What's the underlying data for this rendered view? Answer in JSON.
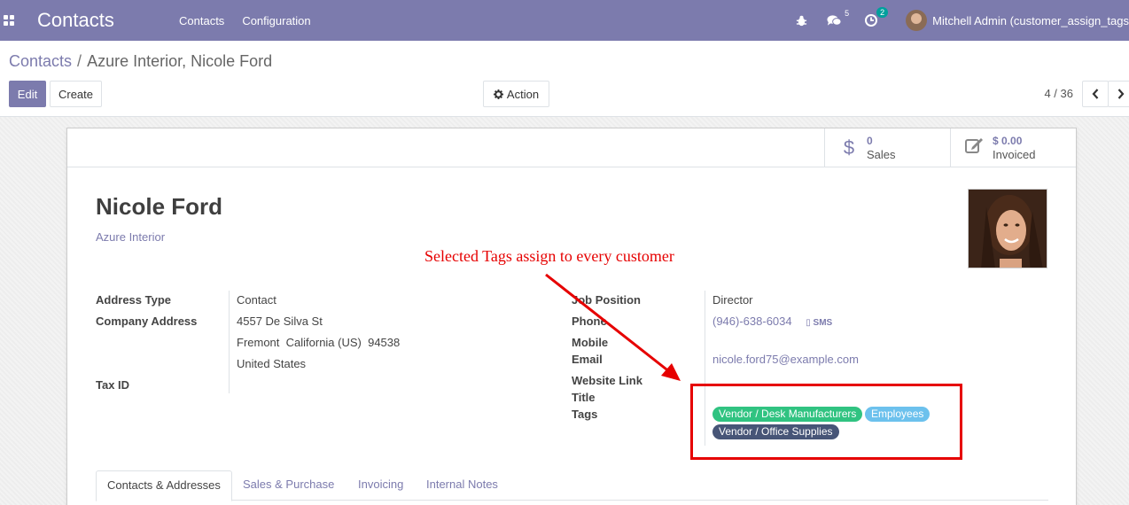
{
  "navbar": {
    "app_title": "Contacts",
    "menu": [
      "Contacts",
      "Configuration"
    ],
    "messages_count": "5",
    "activities_count": "2",
    "user_name": "Mitchell Admin (customer_assign_tags"
  },
  "breadcrumb": {
    "parent": "Contacts",
    "separator": "/",
    "current": "Azure Interior, Nicole Ford"
  },
  "toolbar": {
    "edit_label": "Edit",
    "create_label": "Create",
    "action_label": "Action",
    "pager": "4 / 36"
  },
  "stats": {
    "sales_value": "0",
    "sales_label": "Sales",
    "invoiced_value": "$ 0.00",
    "invoiced_label": "Invoiced"
  },
  "partner": {
    "name": "Nicole Ford",
    "company": "Azure Interior"
  },
  "left_fields": {
    "address_type_label": "Address Type",
    "address_type_value": "Contact",
    "company_address_label": "Company Address",
    "street": "4557 De Silva St",
    "city_line": "Fremont  California (US)  94538",
    "country": "United States",
    "tax_id_label": "Tax ID"
  },
  "right_fields": {
    "job_position_label": "Job Position",
    "job_position_value": "Director",
    "phone_label": "Phone",
    "phone_value": "(946)-638-6034",
    "sms_label": "SMS",
    "mobile_label": "Mobile",
    "email_label": "Email",
    "email_value": "nicole.ford75@example.com",
    "website_label": "Website Link",
    "title_label": "Title",
    "tags_label": "Tags"
  },
  "tags": [
    {
      "label": "Vendor / Desk Manufacturers",
      "color": "#30c381"
    },
    {
      "label": "Employees",
      "color": "#6cc1ed"
    },
    {
      "label": "Vendor / Office Supplies",
      "color": "#475577"
    }
  ],
  "tabs": [
    "Contacts & Addresses",
    "Sales & Purchase",
    "Invoicing",
    "Internal Notes"
  ],
  "annotation": {
    "text": "Selected Tags assign to every customer",
    "color": "#e60000"
  },
  "colors": {
    "brand": "#7c7bad",
    "annotation": "#e60000"
  }
}
